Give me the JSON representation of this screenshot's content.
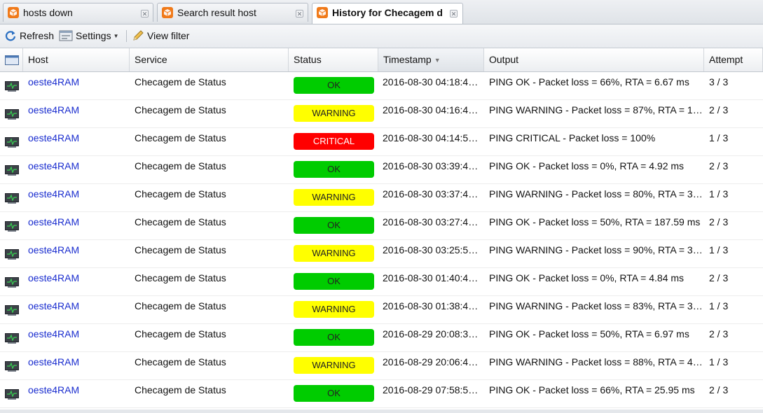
{
  "tabs": [
    {
      "label": "hosts down",
      "active": false,
      "icon": "package-icon"
    },
    {
      "label": "Search result host",
      "active": false,
      "icon": "package-icon"
    },
    {
      "label": "History for Checagem de",
      "active": true,
      "icon": "package-icon"
    }
  ],
  "toolbar": {
    "refresh_label": "Refresh",
    "settings_label": "Settings",
    "view_filter_label": "View filter"
  },
  "columns": {
    "host": "Host",
    "service": "Service",
    "status": "Status",
    "timestamp": "Timestamp",
    "output": "Output",
    "attempt": "Attempt"
  },
  "colors": {
    "OK": "#00cc00",
    "WARNING": "#ffff00",
    "CRITICAL": "#ff0000",
    "link": "#1a2dcf",
    "tab_icon": "#f07a1a"
  },
  "rows": [
    {
      "host": "oeste4RAM",
      "service": "Checagem de Status",
      "status": "OK",
      "timestamp": "2016-08-30 04:18:4…",
      "output": "PING OK - Packet loss = 66%, RTA = 6.67 ms",
      "attempt": "3 / 3"
    },
    {
      "host": "oeste4RAM",
      "service": "Checagem de Status",
      "status": "WARNING",
      "timestamp": "2016-08-30 04:16:4…",
      "output": "PING WARNING - Packet loss = 87%, RTA = 1…",
      "attempt": "2 / 3"
    },
    {
      "host": "oeste4RAM",
      "service": "Checagem de Status",
      "status": "CRITICAL",
      "timestamp": "2016-08-30 04:14:5…",
      "output": "PING CRITICAL - Packet loss = 100%",
      "attempt": "1 / 3"
    },
    {
      "host": "oeste4RAM",
      "service": "Checagem de Status",
      "status": "OK",
      "timestamp": "2016-08-30 03:39:4…",
      "output": "PING OK - Packet loss = 0%, RTA = 4.92 ms",
      "attempt": "2 / 3"
    },
    {
      "host": "oeste4RAM",
      "service": "Checagem de Status",
      "status": "WARNING",
      "timestamp": "2016-08-30 03:37:4…",
      "output": "PING WARNING - Packet loss = 80%, RTA = 3…",
      "attempt": "1 / 3"
    },
    {
      "host": "oeste4RAM",
      "service": "Checagem de Status",
      "status": "OK",
      "timestamp": "2016-08-30 03:27:4…",
      "output": "PING OK - Packet loss = 50%, RTA = 187.59 ms",
      "attempt": "2 / 3"
    },
    {
      "host": "oeste4RAM",
      "service": "Checagem de Status",
      "status": "WARNING",
      "timestamp": "2016-08-30 03:25:5…",
      "output": "PING WARNING - Packet loss = 90%, RTA = 3…",
      "attempt": "1 / 3"
    },
    {
      "host": "oeste4RAM",
      "service": "Checagem de Status",
      "status": "OK",
      "timestamp": "2016-08-30 01:40:4…",
      "output": "PING OK - Packet loss = 0%, RTA = 4.84 ms",
      "attempt": "2 / 3"
    },
    {
      "host": "oeste4RAM",
      "service": "Checagem de Status",
      "status": "WARNING",
      "timestamp": "2016-08-30 01:38:4…",
      "output": "PING WARNING - Packet loss = 83%, RTA = 3…",
      "attempt": "1 / 3"
    },
    {
      "host": "oeste4RAM",
      "service": "Checagem de Status",
      "status": "OK",
      "timestamp": "2016-08-29 20:08:3…",
      "output": "PING OK - Packet loss = 50%, RTA = 6.97 ms",
      "attempt": "2 / 3"
    },
    {
      "host": "oeste4RAM",
      "service": "Checagem de Status",
      "status": "WARNING",
      "timestamp": "2016-08-29 20:06:4…",
      "output": "PING WARNING - Packet loss = 88%, RTA = 4…",
      "attempt": "1 / 3"
    },
    {
      "host": "oeste4RAM",
      "service": "Checagem de Status",
      "status": "OK",
      "timestamp": "2016-08-29 07:58:5…",
      "output": "PING OK - Packet loss = 66%, RTA = 25.95 ms",
      "attempt": "2 / 3"
    }
  ]
}
